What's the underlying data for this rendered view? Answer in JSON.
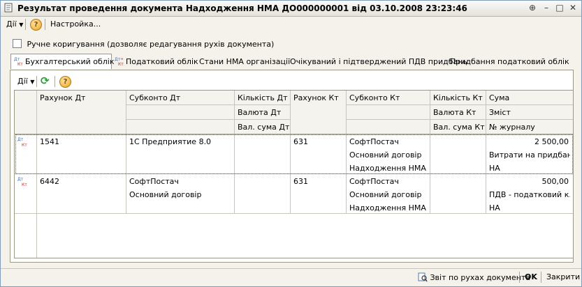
{
  "window": {
    "title": "Результат проведення документа Надходження НМА ДО000000001 від 03.10.2008 23:23:46",
    "buttons": {
      "pin": "⊕",
      "minimize": "–",
      "maximize": "□",
      "close": "✕"
    }
  },
  "menubar": {
    "actions": "Дії",
    "settings": "Настройка..."
  },
  "manual_edit": {
    "label": "Ручне коригування (дозволяє редагування рухів документа)",
    "checked": false
  },
  "tabs": [
    {
      "label": "Бухгалтерський облік",
      "active": true
    },
    {
      "label": "Податковий облік",
      "active": false
    },
    {
      "label": "Стани НМА організації",
      "active": false
    },
    {
      "label": "Очікуваний і підтверджений ПДВ придбань",
      "active": false
    },
    {
      "label": "Придбання податковий облік",
      "active": false
    }
  ],
  "subtoolbar": {
    "actions": "Дії"
  },
  "table": {
    "headers": {
      "dt_account": "Рахунок Дт",
      "dt_subconto": "Субконто Дт",
      "dt_qty": "Кількість Дт",
      "dt_currency": "Валюта Дт",
      "dt_cur_sum": "Вал. сума Дт",
      "kt_account": "Рахунок Кт",
      "kt_subconto": "Субконто Кт",
      "kt_qty": "Кількість Кт",
      "kt_currency": "Валюта Кт",
      "kt_cur_sum": "Вал. сума Кт",
      "sum": "Сума",
      "content": "Зміст",
      "journal": "№ журналу"
    },
    "rows": [
      {
        "dt_account": "1541",
        "dt_subconto": [
          "1С Предприятие 8.0",
          "",
          ""
        ],
        "kt_account": "631",
        "kt_subconto": [
          "СофтПостач",
          "Основний договір",
          "Надходження НМА ..."
        ],
        "sum": "2 500,00",
        "content": "Витрати на придбан...",
        "journal": "НА"
      },
      {
        "dt_account": "6442",
        "dt_subconto": [
          "СофтПостач",
          "Основний договір",
          ""
        ],
        "kt_account": "631",
        "kt_subconto": [
          "СофтПостач",
          "Основний договір",
          "Надходження НМА ..."
        ],
        "sum": "500,00",
        "content": "ПДВ - податковий к...",
        "journal": "НА"
      }
    ]
  },
  "statusbar": {
    "report": "Звіт по рухах документа",
    "ok": "OK",
    "close": "Закрити"
  },
  "colors": {
    "dt_icon": "#3d6fbf",
    "kt_icon": "#c62828",
    "refresh": "#2e9e3a"
  }
}
